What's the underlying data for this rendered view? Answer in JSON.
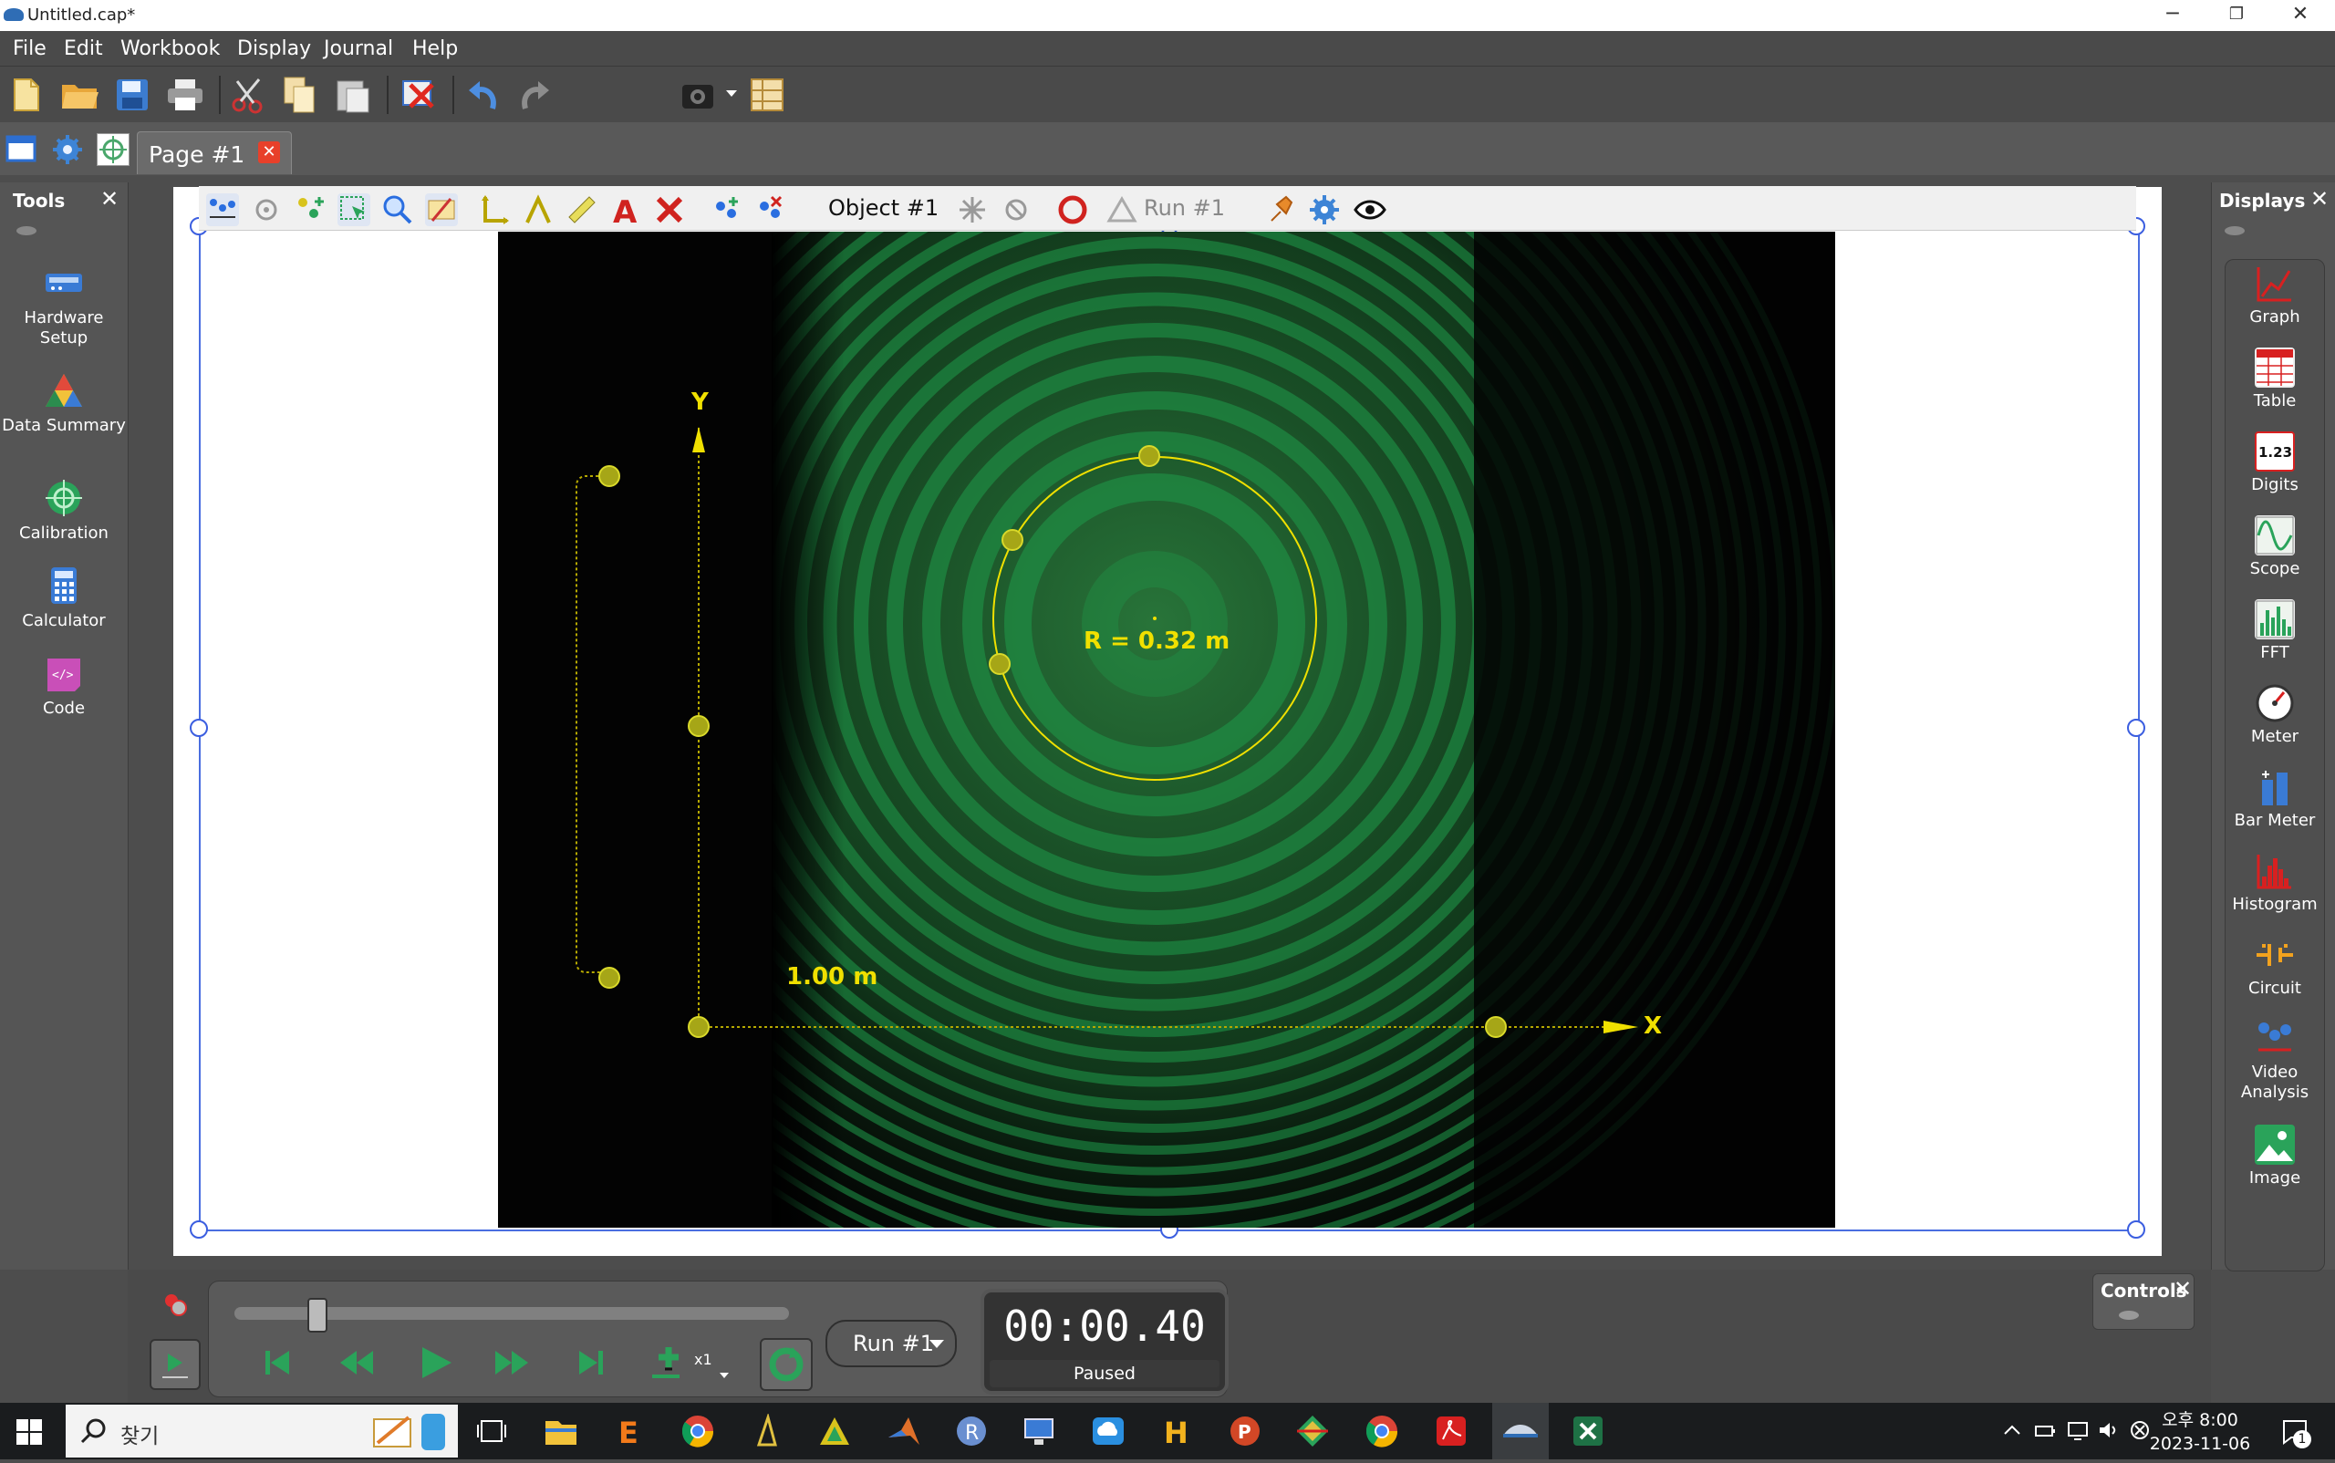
{
  "window": {
    "title": "Untitled.cap*",
    "min": "─",
    "restore": "❐",
    "close": "✕"
  },
  "menu": [
    "File",
    "Edit",
    "Workbook",
    "Display",
    "Journal",
    "Help"
  ],
  "toolbar": {
    "icons": [
      "new-icon",
      "open-folder-icon",
      "save-icon",
      "print-icon",
      "cut-icon",
      "copy-icon",
      "paste-icon",
      "delete-icon",
      "undo-icon",
      "redo-icon",
      "camera-icon",
      "layout-icon"
    ]
  },
  "tabs": {
    "page_label": "Page #1",
    "close": "✕"
  },
  "tools_palette": {
    "title": "Tools",
    "close": "✕",
    "items": [
      {
        "label": "Hardware Setup"
      },
      {
        "label": "Data Summary"
      },
      {
        "label": "Calibration"
      },
      {
        "label": "Calculator"
      },
      {
        "label": "Code"
      }
    ]
  },
  "object_toolbar": {
    "object_label": "Object #1",
    "run_label": "Run #1"
  },
  "video": {
    "radius_label": "R = 0.32 m",
    "scale_label": "1.00 m",
    "axis_x": "X",
    "axis_y": "Y",
    "colors": {
      "ring": "#1f9a4a",
      "overlay": "#f0e000",
      "point": "#a6a617"
    }
  },
  "displays_palette": {
    "title": "Displays",
    "close": "✕",
    "items": [
      {
        "label": "Graph"
      },
      {
        "label": "Table"
      },
      {
        "label": "Digits"
      },
      {
        "label": "Scope"
      },
      {
        "label": "FFT"
      },
      {
        "label": "Meter"
      },
      {
        "label": "Bar Meter"
      },
      {
        "label": "Histogram"
      },
      {
        "label": "Circuit"
      },
      {
        "label": "Video Analysis"
      },
      {
        "label": "Image"
      }
    ]
  },
  "controls": {
    "title": "Controls",
    "close": "✕",
    "speed": "x1",
    "run_select": "Run #1",
    "time": "00:00.40",
    "state": "Paused",
    "playback_progress": 0.15
  },
  "taskbar": {
    "search_placeholder": "찾기",
    "clock_period": "오후 8:00",
    "date": "2023-11-06",
    "notification_count": "1"
  }
}
